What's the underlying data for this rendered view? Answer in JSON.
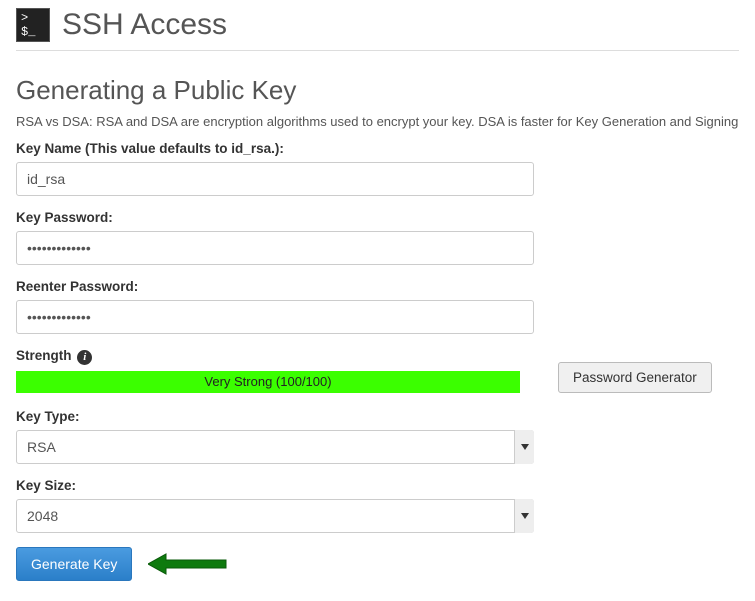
{
  "header": {
    "icon_text": "> $_",
    "title": "SSH Access"
  },
  "sub_heading": "Generating a Public Key",
  "help_text": "RSA vs DSA: RSA and DSA are encryption algorithms used to encrypt your key. DSA is faster for Key Generation and Signing and",
  "form": {
    "key_name_label": "Key Name (This value defaults to id_rsa.):",
    "key_name_value": "id_rsa",
    "key_password_label": "Key Password:",
    "key_password_value": "•••••••••••••",
    "reenter_password_label": "Reenter Password:",
    "reenter_password_value": "•••••••••••••",
    "strength_label": "Strength",
    "strength_text": "Very Strong (100/100)",
    "password_generator_label": "Password Generator",
    "key_type_label": "Key Type:",
    "key_type_value": "RSA",
    "key_size_label": "Key Size:",
    "key_size_value": "2048",
    "generate_label": "Generate Key"
  }
}
